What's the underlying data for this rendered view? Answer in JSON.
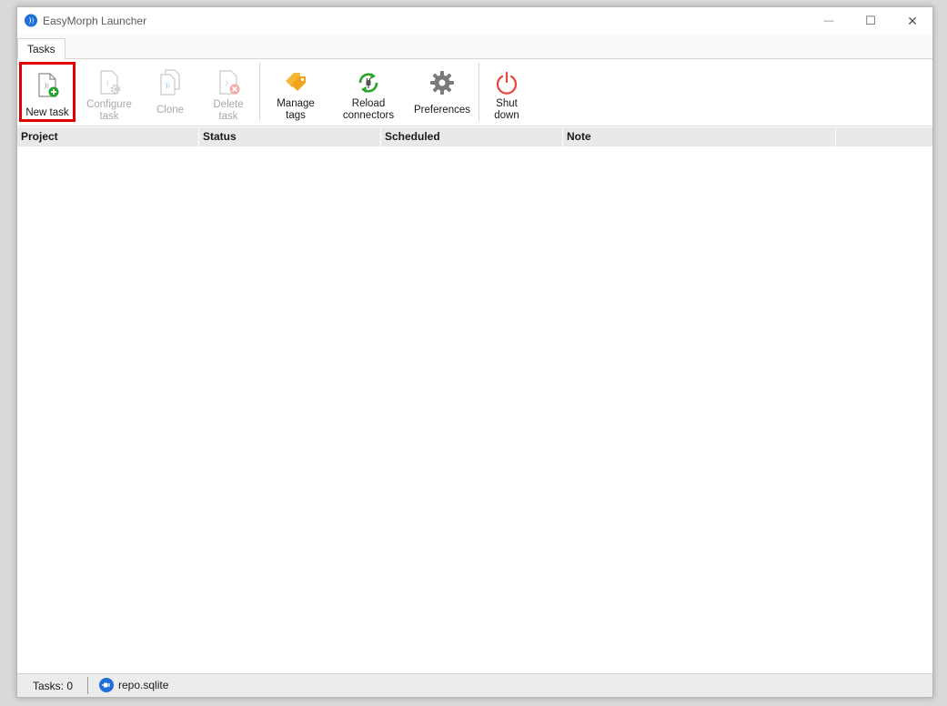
{
  "window": {
    "title": "EasyMorph Launcher",
    "controls": {
      "minimize": "—",
      "maximize": "☐",
      "close": "✕"
    }
  },
  "tabs": [
    {
      "label": "Tasks",
      "active": true
    }
  ],
  "toolbar": {
    "new_task": {
      "label": "New task",
      "icon": "new-task-icon",
      "enabled": true,
      "highlighted": true
    },
    "configure_task": {
      "label": "Configure\ntask",
      "icon": "configure-task-icon",
      "enabled": false
    },
    "clone": {
      "label": "Clone",
      "icon": "clone-icon",
      "enabled": false
    },
    "delete_task": {
      "label": "Delete\ntask",
      "icon": "delete-task-icon",
      "enabled": false
    },
    "manage_tags": {
      "label": "Manage\ntags",
      "icon": "tags-icon",
      "enabled": true
    },
    "reload_connectors": {
      "label": "Reload\nconnectors",
      "icon": "reload-connectors-icon",
      "enabled": true
    },
    "preferences": {
      "label": "Preferences",
      "icon": "gear-icon",
      "enabled": true
    },
    "shut_down": {
      "label": "Shut\ndown",
      "icon": "power-icon",
      "enabled": true
    }
  },
  "grid": {
    "columns": [
      "Project",
      "Status",
      "Scheduled",
      "Note"
    ],
    "rows": []
  },
  "statusbar": {
    "task_count": "Tasks: 0",
    "database": "repo.sqlite"
  },
  "colors": {
    "highlight": "#e00000",
    "accent_blue": "#1e6fd9",
    "tags_orange": "#f2a21b",
    "reload_green": "#2aa52a",
    "power_red": "#e8453c"
  }
}
